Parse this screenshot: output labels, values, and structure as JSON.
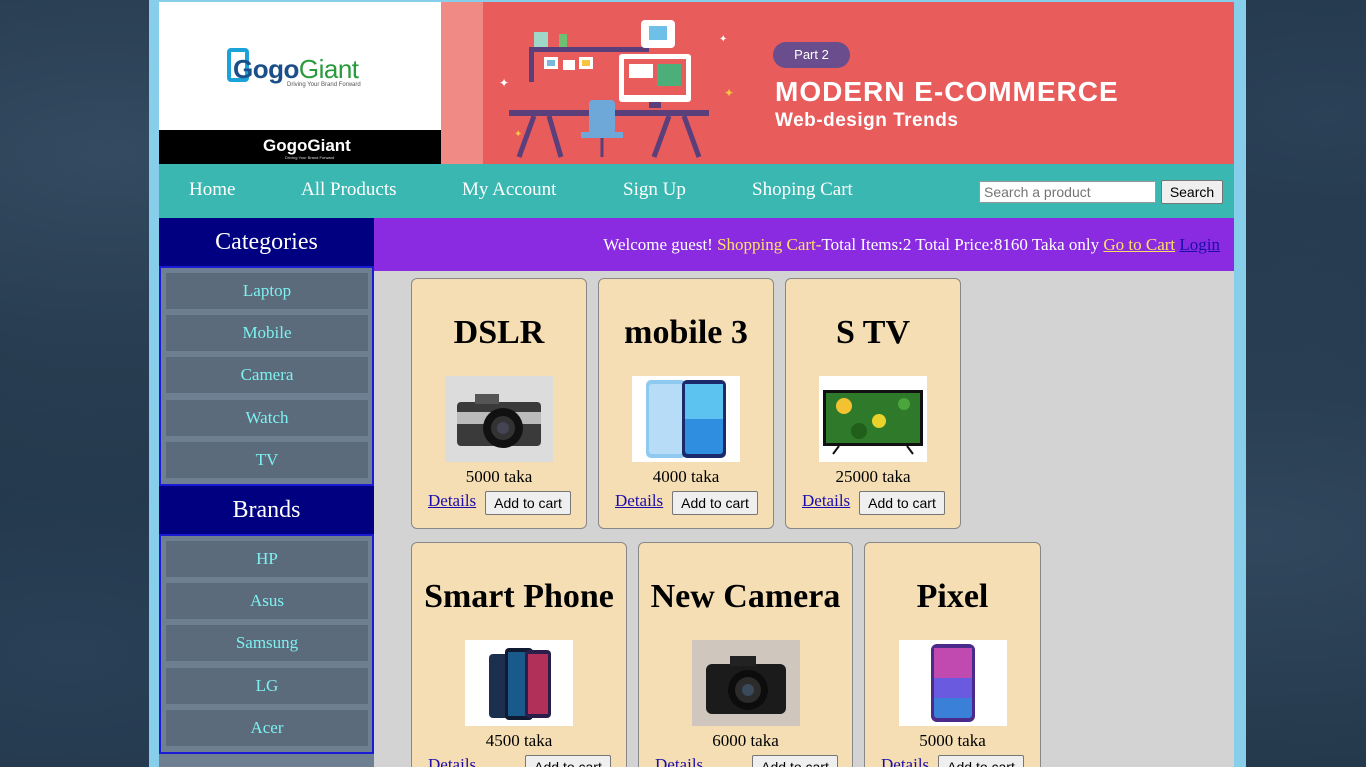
{
  "header": {
    "logo_text_1": "Gogo",
    "logo_text_2": "Giant",
    "logo_tagline": "Driving Your Brand Forward",
    "logo_small_text": "GogoGiant",
    "logo_small_tagline": "Driving Your Brand Forward",
    "banner_part": "Part 2",
    "banner_title": "MODERN E-COMMERCE",
    "banner_subtitle": "Web-design Trends"
  },
  "nav": {
    "items": [
      {
        "label": "Home"
      },
      {
        "label": "All Products"
      },
      {
        "label": "My Account"
      },
      {
        "label": "Sign Up"
      },
      {
        "label": "Shoping Cart"
      }
    ],
    "search_placeholder": "Search a product",
    "search_button": "Search"
  },
  "sidebar": {
    "categories_title": "Categories",
    "categories": [
      "Laptop",
      "Mobile",
      "Camera",
      "Watch",
      "TV"
    ],
    "brands_title": "Brands",
    "brands": [
      "HP",
      "Asus",
      "Samsung",
      "LG",
      "Acer"
    ]
  },
  "welcome": {
    "greeting": "Welcome guest!",
    "cart_label": "Shopping Cart-",
    "cart_summary": "Total Items:2 Total Price:8160 Taka only",
    "go_to_cart": "Go to Cart",
    "login": "Login"
  },
  "products": [
    {
      "title": "DSLR",
      "price": "5000 taka",
      "details": "Details",
      "add": "Add to cart",
      "image_icon": "camera-dslr"
    },
    {
      "title": "mobile 3",
      "price": "4000 taka",
      "details": "Details",
      "add": "Add to cart",
      "image_icon": "smartphone"
    },
    {
      "title": "S TV",
      "price": "25000 taka",
      "details": "Details",
      "add": "Add to cart",
      "image_icon": "television"
    },
    {
      "title": "Smart Phone",
      "price": "4500 taka",
      "details": "Details",
      "add": "Add to cart",
      "image_icon": "smartphones"
    },
    {
      "title": "New Camera",
      "price": "6000 taka",
      "details": "Details",
      "add": "Add to cart",
      "image_icon": "camera"
    },
    {
      "title": "Pixel",
      "price": "5000 taka",
      "details": "Details",
      "add": "Add to cart",
      "image_icon": "smartphone"
    }
  ],
  "colors": {
    "nav_bg": "#3bb7b1",
    "welcome_bg": "#8a2be2",
    "sidebar_head_bg": "#000080",
    "card_bg": "#f5deb3",
    "banner_bg": "#e85c5c"
  }
}
